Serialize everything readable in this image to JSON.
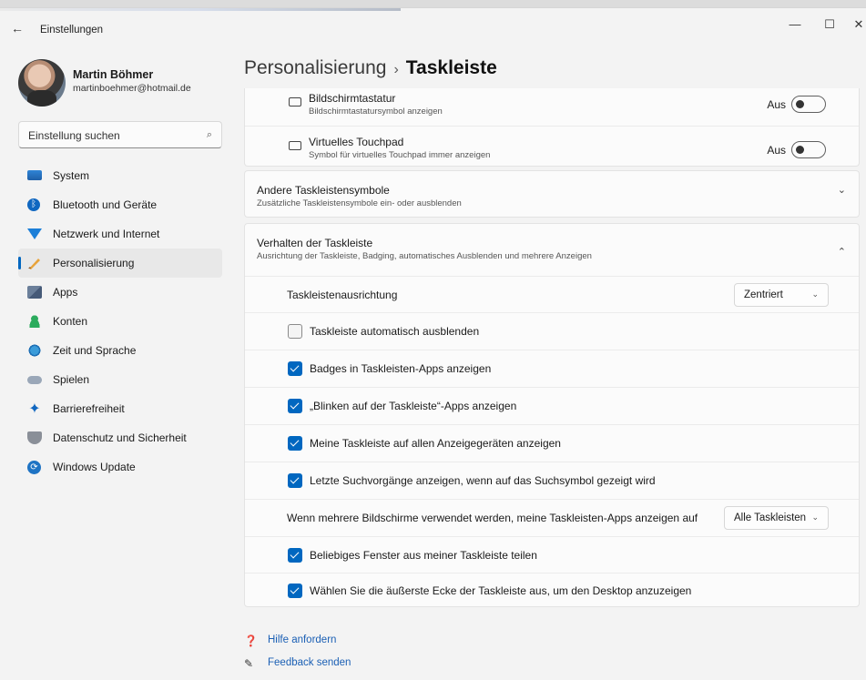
{
  "window": {
    "title": "Einstellungen",
    "back_icon": "←",
    "minimize_icon": "—",
    "maximize_icon": "☐",
    "close_icon": "✕"
  },
  "profile": {
    "name": "Martin Böhmer",
    "email": "martinboehmer@hotmail.de"
  },
  "search": {
    "placeholder": "Einstellung suchen",
    "icon": "⌕"
  },
  "sidebar": {
    "items": [
      {
        "label": "System",
        "icon": "system-icon"
      },
      {
        "label": "Bluetooth und Geräte",
        "icon": "bluetooth-icon"
      },
      {
        "label": "Netzwerk und Internet",
        "icon": "network-icon"
      },
      {
        "label": "Personalisierung",
        "icon": "brush-icon",
        "active": true
      },
      {
        "label": "Apps",
        "icon": "apps-icon"
      },
      {
        "label": "Konten",
        "icon": "account-icon"
      },
      {
        "label": "Zeit und Sprache",
        "icon": "clock-globe-icon"
      },
      {
        "label": "Spielen",
        "icon": "gamepad-icon"
      },
      {
        "label": "Barrierefreiheit",
        "icon": "accessibility-icon"
      },
      {
        "label": "Datenschutz und Sicherheit",
        "icon": "shield-icon"
      },
      {
        "label": "Windows Update",
        "icon": "update-icon"
      }
    ]
  },
  "breadcrumb": {
    "parent": "Personalisierung",
    "separator": "›",
    "current": "Taskleiste"
  },
  "tray_icons": {
    "keyboard": {
      "title": "Bildschirmtastatur",
      "subtitle": "Bildschirmtastatursymbol anzeigen",
      "state": "Aus"
    },
    "touchpad": {
      "title": "Virtuelles Touchpad",
      "subtitle": "Symbol für virtuelles Touchpad immer anzeigen",
      "state": "Aus"
    }
  },
  "other_icons": {
    "title": "Andere Taskleistensymbole",
    "subtitle": "Zusätzliche Taskleistensymbole ein- oder ausblenden",
    "chevron": "⌄"
  },
  "behavior": {
    "title": "Verhalten der Taskleiste",
    "subtitle": "Ausrichtung der Taskleiste, Badging, automatisches Ausblenden und mehrere Anzeigen",
    "chevron": "⌃",
    "alignment_label": "Taskleistenausrichtung",
    "alignment_value": "Zentriert",
    "dropdown_chevron": "⌄",
    "options": [
      {
        "label": "Taskleiste automatisch ausblenden",
        "checked": false
      },
      {
        "label": "Badges in Taskleisten-Apps anzeigen",
        "checked": true
      },
      {
        "label": "„Blinken auf der Taskleiste“-Apps anzeigen",
        "checked": true
      },
      {
        "label": "Meine Taskleiste auf allen Anzeigegeräten anzeigen",
        "checked": true
      },
      {
        "label": "Letzte Suchvorgänge anzeigen, wenn auf das Suchsymbol gezeigt wird",
        "checked": true
      }
    ],
    "multi_label": "Wenn mehrere Bildschirme verwendet werden, meine Taskleisten-Apps anzeigen auf",
    "multi_value": "Alle Taskleisten",
    "options2": [
      {
        "label": "Beliebiges Fenster aus meiner Taskleiste teilen",
        "checked": true
      },
      {
        "label": "Wählen Sie die äußerste Ecke der Taskleiste aus, um den Desktop anzuzeigen",
        "checked": true
      }
    ]
  },
  "footer": {
    "help": "Hilfe anfordern",
    "feedback": "Feedback senden"
  },
  "colors": {
    "accent": "#0067c0",
    "link": "#1a5fb4"
  }
}
